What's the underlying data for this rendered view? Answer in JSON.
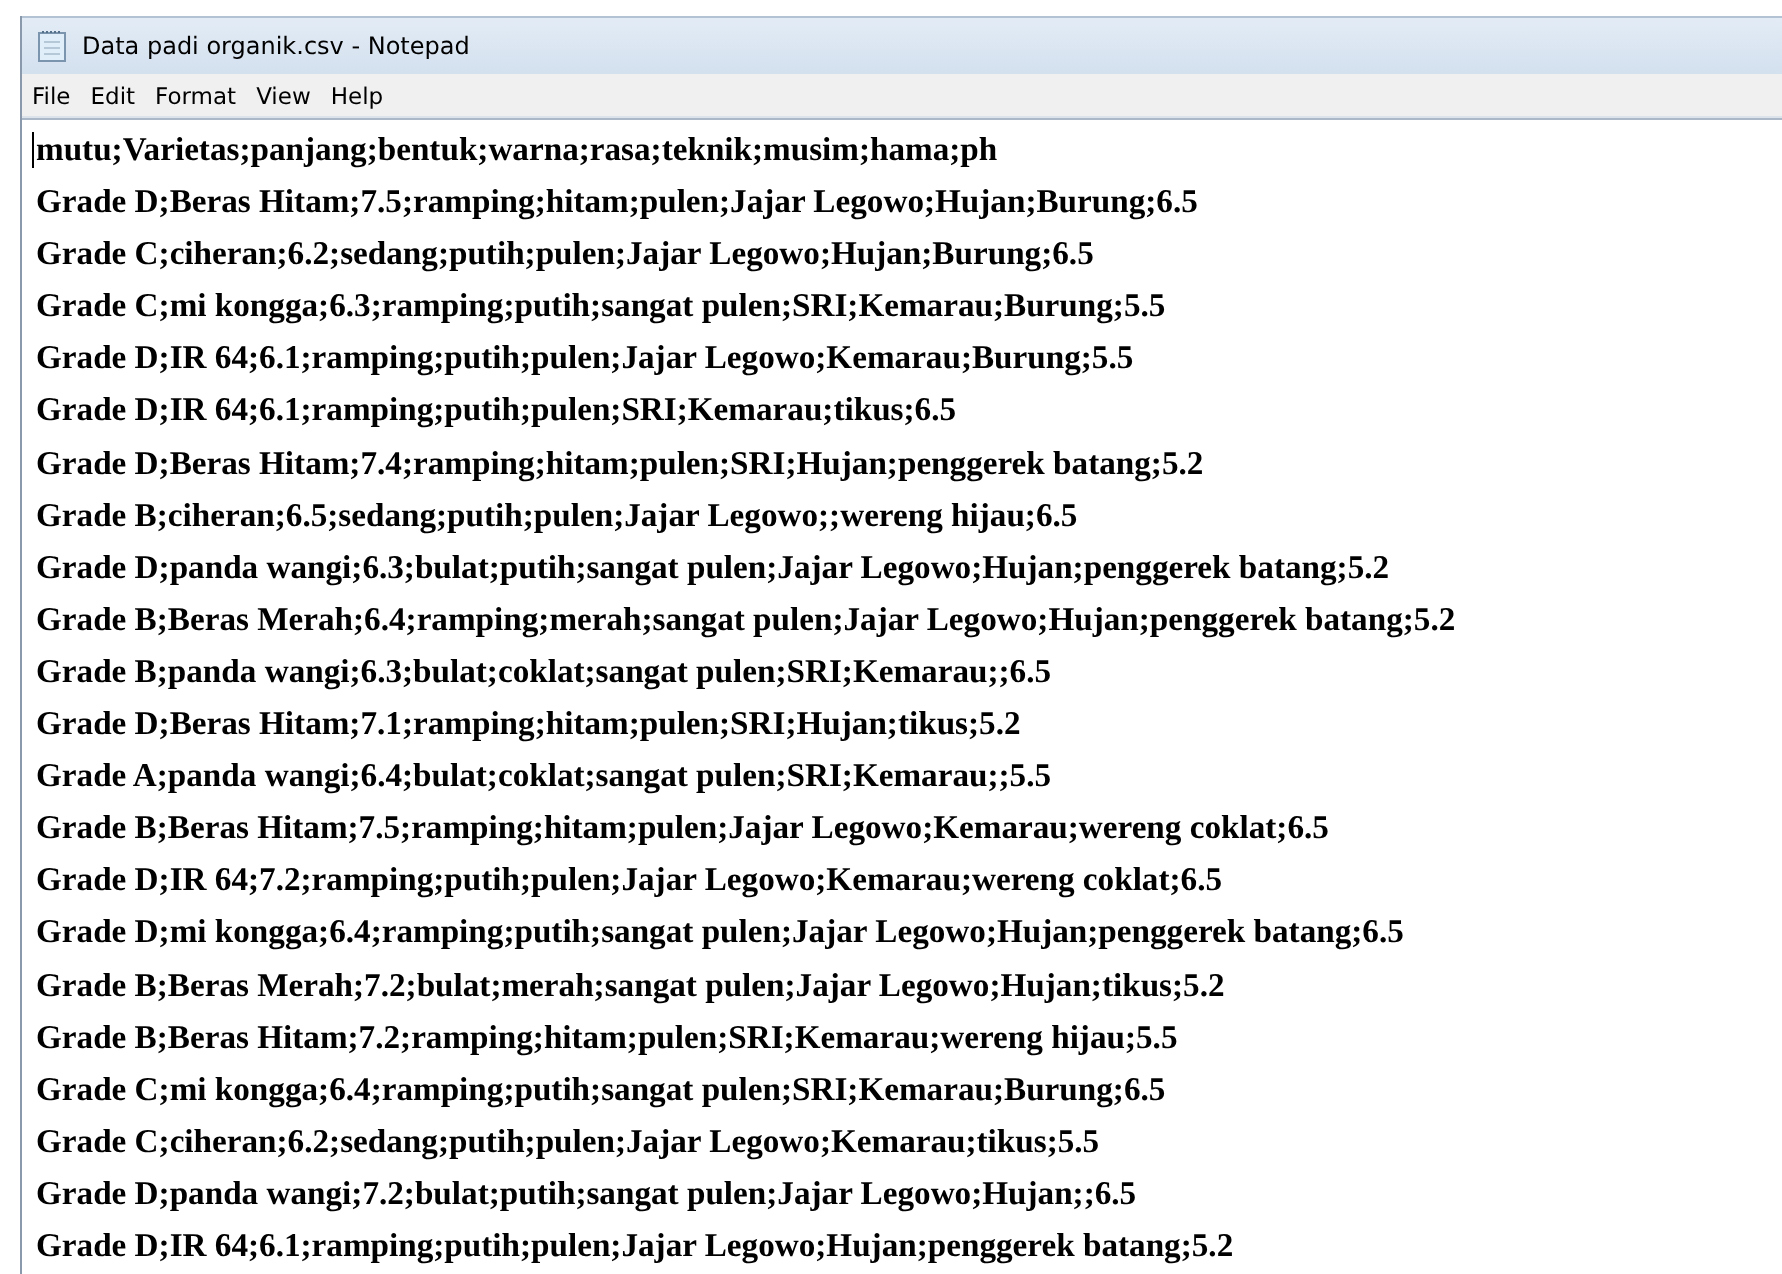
{
  "window": {
    "title": "Data padi organik.csv - Notepad"
  },
  "menu": [
    "File",
    "Edit",
    "Format",
    "View",
    "Help"
  ],
  "editor": {
    "lines": [
      "mutu;Varietas;panjang;bentuk;warna;rasa;teknik;musim;hama;ph",
      "Grade D;Beras Hitam;7.5;ramping;hitam;pulen;Jajar Legowo;Hujan;Burung;6.5",
      "Grade C;ciheran;6.2;sedang;putih;pulen;Jajar Legowo;Hujan;Burung;6.5",
      "Grade C;mi kongga;6.3;ramping;putih;sangat pulen;SRI;Kemarau;Burung;5.5",
      "Grade D;IR 64;6.1;ramping;putih;pulen;Jajar Legowo;Kemarau;Burung;5.5",
      "Grade D;IR 64;6.1;ramping;putih;pulen;SRI;Kemarau;tikus;6.5",
      "Grade D;Beras Hitam;7.4;ramping;hitam;pulen;SRI;Hujan;penggerek batang;5.2",
      "Grade B;ciheran;6.5;sedang;putih;pulen;Jajar Legowo;;wereng hijau;6.5",
      "Grade D;panda wangi;6.3;bulat;putih;sangat pulen;Jajar Legowo;Hujan;penggerek batang;5.2",
      "Grade B;Beras Merah;6.4;ramping;merah;sangat pulen;Jajar Legowo;Hujan;penggerek batang;5.2",
      "Grade B;panda wangi;6.3;bulat;coklat;sangat pulen;SRI;Kemarau;;6.5",
      "Grade D;Beras Hitam;7.1;ramping;hitam;pulen;SRI;Hujan;tikus;5.2",
      "Grade A;panda wangi;6.4;bulat;coklat;sangat pulen;SRI;Kemarau;;5.5",
      "Grade B;Beras Hitam;7.5;ramping;hitam;pulen;Jajar Legowo;Kemarau;wereng coklat;6.5",
      "Grade D;IR 64;7.2;ramping;putih;pulen;Jajar Legowo;Kemarau;wereng coklat;6.5",
      "Grade D;mi kongga;6.4;ramping;putih;sangat pulen;Jajar Legowo;Hujan;penggerek batang;6.5",
      "Grade B;Beras Merah;7.2;bulat;merah;sangat pulen;Jajar Legowo;Hujan;tikus;5.2",
      "Grade B;Beras Hitam;7.2;ramping;hitam;pulen;SRI;Kemarau;wereng hijau;5.5",
      "Grade C;mi kongga;6.4;ramping;putih;sangat pulen;SRI;Kemarau;Burung;6.5",
      "Grade C;ciheran;6.2;sedang;putih;pulen;Jajar Legowo;Kemarau;tikus;5.5",
      "Grade D;panda wangi;7.2;bulat;putih;sangat pulen;Jajar Legowo;Hujan;;6.5",
      "Grade D;IR 64;6.1;ramping;putih;pulen;Jajar Legowo;Hujan;penggerek batang;5.2"
    ]
  }
}
